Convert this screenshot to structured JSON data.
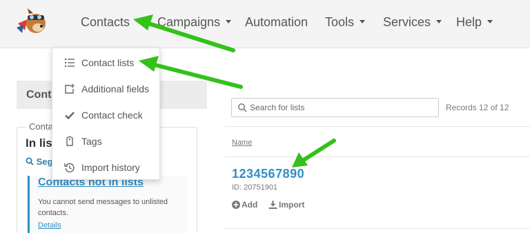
{
  "nav": {
    "items": [
      {
        "label": "Contacts",
        "has_caret": false
      },
      {
        "label": "Campaigns",
        "has_caret": true
      },
      {
        "label": "Automation",
        "has_caret": false
      },
      {
        "label": "Tools",
        "has_caret": true
      },
      {
        "label": "Services",
        "has_caret": true
      },
      {
        "label": "Help",
        "has_caret": true
      }
    ]
  },
  "dropdown": {
    "items": [
      {
        "label": "Contact lists",
        "icon": "list-icon"
      },
      {
        "label": "Additional fields",
        "icon": "add-field-icon"
      },
      {
        "label": "Contact check",
        "icon": "checkmark-icon"
      },
      {
        "label": "Tags",
        "icon": "tag-icon"
      },
      {
        "label": "Import history",
        "icon": "history-icon"
      }
    ]
  },
  "left": {
    "title": "Conta",
    "legend": "Conta",
    "in_lists": "In list",
    "segment": "Seg",
    "notice": {
      "title": "Contacts not in lists",
      "text": "You cannot send messages to unlisted contacts.",
      "link": "Details"
    }
  },
  "main": {
    "search_placeholder": "Search for lists",
    "records": "Records 12 of 12",
    "column_name": "Name",
    "list": {
      "name": "1234567890",
      "id": "ID: 20751901",
      "add_label": "Add",
      "import_label": "Import"
    }
  },
  "colors": {
    "accent": "#2f8fc4",
    "annotation_arrow": "#33c11a",
    "topbar": "#f4f4f4"
  }
}
